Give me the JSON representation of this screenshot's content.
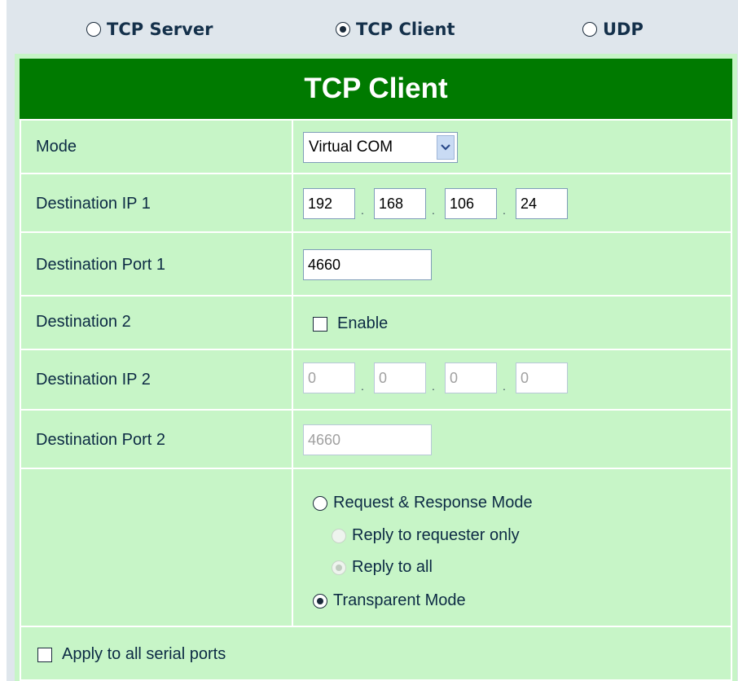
{
  "mode_tabs": [
    {
      "label": "TCP Server",
      "selected": false
    },
    {
      "label": "TCP Client",
      "selected": true
    },
    {
      "label": "UDP",
      "selected": false
    }
  ],
  "panel": {
    "title": "TCP Client",
    "rows": {
      "mode": {
        "label": "Mode",
        "value": "Virtual COM"
      },
      "dest_ip1": {
        "label": "Destination IP 1",
        "octets": [
          "192",
          "168",
          "106",
          "24"
        ],
        "separator": "."
      },
      "dest_port1": {
        "label": "Destination Port 1",
        "value": "4660"
      },
      "dest2": {
        "label": "Destination 2",
        "checkbox_label": "Enable",
        "checked": false
      },
      "dest_ip2": {
        "label": "Destination IP 2",
        "octets": [
          "0",
          "0",
          "0",
          "0"
        ],
        "separator": "."
      },
      "dest_port2": {
        "label": "Destination Port 2",
        "value": "4660"
      }
    },
    "transfer_mode": {
      "request_response": {
        "label": "Request & Response Mode",
        "selected": false
      },
      "reply_requester": {
        "label": "Reply to requester only",
        "selected": false,
        "disabled": true
      },
      "reply_all": {
        "label": "Reply to all",
        "selected": true,
        "disabled": true
      },
      "transparent": {
        "label": "Transparent Mode",
        "selected": true
      }
    },
    "apply_all": {
      "label": "Apply to all serial ports",
      "checked": false
    }
  },
  "colors": {
    "header_bg": "#007a00",
    "panel_bg": "#c7f5c7",
    "frame_bg": "#dfe6ec"
  }
}
